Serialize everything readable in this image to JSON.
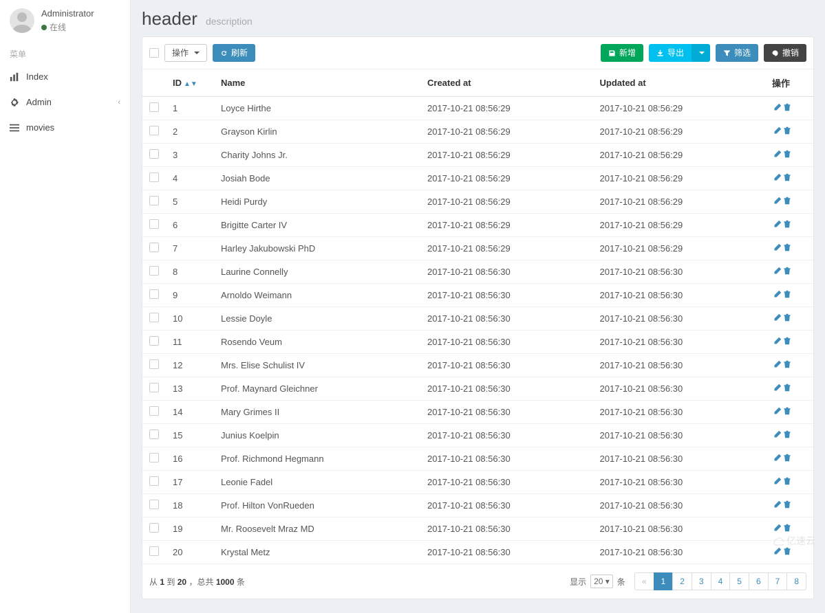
{
  "sidebar": {
    "user": {
      "name": "Administrator",
      "status": "在线"
    },
    "menu_header": "菜单",
    "items": [
      {
        "label": "Index",
        "icon": "bar-chart-icon",
        "expandable": false
      },
      {
        "label": "Admin",
        "icon": "gear-icon",
        "expandable": true
      },
      {
        "label": "movies",
        "icon": "bars-icon",
        "expandable": false
      }
    ]
  },
  "page": {
    "title": "header",
    "description": "description"
  },
  "toolbar": {
    "action_label": "操作",
    "refresh_label": "刷新",
    "new_label": "新增",
    "export_label": "导出",
    "filter_label": "筛选",
    "undo_label": "撤销"
  },
  "table": {
    "columns": {
      "id": "ID",
      "name": "Name",
      "created_at": "Created at",
      "updated_at": "Updated at",
      "ops": "操作"
    },
    "rows": [
      {
        "id": "1",
        "name": "Loyce Hirthe",
        "created_at": "2017-10-21 08:56:29",
        "updated_at": "2017-10-21 08:56:29"
      },
      {
        "id": "2",
        "name": "Grayson Kirlin",
        "created_at": "2017-10-21 08:56:29",
        "updated_at": "2017-10-21 08:56:29"
      },
      {
        "id": "3",
        "name": "Charity Johns Jr.",
        "created_at": "2017-10-21 08:56:29",
        "updated_at": "2017-10-21 08:56:29"
      },
      {
        "id": "4",
        "name": "Josiah Bode",
        "created_at": "2017-10-21 08:56:29",
        "updated_at": "2017-10-21 08:56:29"
      },
      {
        "id": "5",
        "name": "Heidi Purdy",
        "created_at": "2017-10-21 08:56:29",
        "updated_at": "2017-10-21 08:56:29"
      },
      {
        "id": "6",
        "name": "Brigitte Carter IV",
        "created_at": "2017-10-21 08:56:29",
        "updated_at": "2017-10-21 08:56:29"
      },
      {
        "id": "7",
        "name": "Harley Jakubowski PhD",
        "created_at": "2017-10-21 08:56:29",
        "updated_at": "2017-10-21 08:56:29"
      },
      {
        "id": "8",
        "name": "Laurine Connelly",
        "created_at": "2017-10-21 08:56:30",
        "updated_at": "2017-10-21 08:56:30"
      },
      {
        "id": "9",
        "name": "Arnoldo Weimann",
        "created_at": "2017-10-21 08:56:30",
        "updated_at": "2017-10-21 08:56:30"
      },
      {
        "id": "10",
        "name": "Lessie Doyle",
        "created_at": "2017-10-21 08:56:30",
        "updated_at": "2017-10-21 08:56:30"
      },
      {
        "id": "11",
        "name": "Rosendo Veum",
        "created_at": "2017-10-21 08:56:30",
        "updated_at": "2017-10-21 08:56:30"
      },
      {
        "id": "12",
        "name": "Mrs. Elise Schulist IV",
        "created_at": "2017-10-21 08:56:30",
        "updated_at": "2017-10-21 08:56:30"
      },
      {
        "id": "13",
        "name": "Prof. Maynard Gleichner",
        "created_at": "2017-10-21 08:56:30",
        "updated_at": "2017-10-21 08:56:30"
      },
      {
        "id": "14",
        "name": "Mary Grimes II",
        "created_at": "2017-10-21 08:56:30",
        "updated_at": "2017-10-21 08:56:30"
      },
      {
        "id": "15",
        "name": "Junius Koelpin",
        "created_at": "2017-10-21 08:56:30",
        "updated_at": "2017-10-21 08:56:30"
      },
      {
        "id": "16",
        "name": "Prof. Richmond Hegmann",
        "created_at": "2017-10-21 08:56:30",
        "updated_at": "2017-10-21 08:56:30"
      },
      {
        "id": "17",
        "name": "Leonie Fadel",
        "created_at": "2017-10-21 08:56:30",
        "updated_at": "2017-10-21 08:56:30"
      },
      {
        "id": "18",
        "name": "Prof. Hilton VonRueden",
        "created_at": "2017-10-21 08:56:30",
        "updated_at": "2017-10-21 08:56:30"
      },
      {
        "id": "19",
        "name": "Mr. Roosevelt Mraz MD",
        "created_at": "2017-10-21 08:56:30",
        "updated_at": "2017-10-21 08:56:30"
      },
      {
        "id": "20",
        "name": "Krystal Metz",
        "created_at": "2017-10-21 08:56:30",
        "updated_at": "2017-10-21 08:56:30"
      }
    ]
  },
  "footer": {
    "summary_prefix": "从",
    "from": "1",
    "to_word": "到",
    "to": "20",
    "sep": "，",
    "total_word": "总共",
    "total": "1000",
    "unit": "条",
    "show_label": "显示",
    "per_page": "20",
    "pages": [
      "«",
      "1",
      "2",
      "3",
      "4",
      "5",
      "6",
      "7",
      "8"
    ],
    "active_page": "1"
  },
  "watermark": "亿速云"
}
